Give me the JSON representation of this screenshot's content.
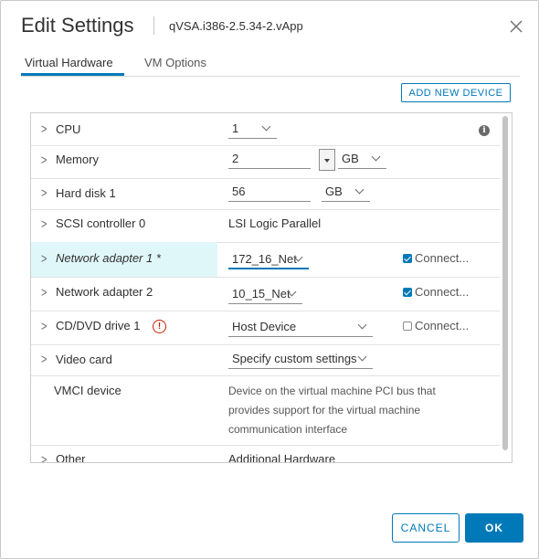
{
  "dialog": {
    "title": "Edit Settings",
    "subtitle": "qVSA.i386-2.5.34-2.vApp"
  },
  "tabs": [
    {
      "label": "Virtual Hardware",
      "active": true
    },
    {
      "label": "VM Options",
      "active": false
    }
  ],
  "add_device_label": "ADD NEW DEVICE",
  "rows": {
    "cpu": {
      "label": "CPU",
      "value": "1"
    },
    "memory": {
      "label": "Memory",
      "value": "2",
      "unit": "GB"
    },
    "hard_disk": {
      "label": "Hard disk 1",
      "value": "56",
      "unit": "GB"
    },
    "scsi": {
      "label": "SCSI controller 0",
      "value": "LSI Logic Parallel"
    },
    "net1": {
      "label": "Network adapter 1 *",
      "value": "172_16_Net",
      "connect_label": "Connect...",
      "connected": true
    },
    "net2": {
      "label": "Network adapter 2",
      "value": "10_15_Net",
      "connect_label": "Connect...",
      "connected": true
    },
    "cd": {
      "label": "CD/DVD drive 1",
      "value": "Host Device",
      "connect_label": "Connect...",
      "connected": false
    },
    "video": {
      "label": "Video card",
      "value": "Specify custom settings"
    },
    "vmci": {
      "label": "VMCI device",
      "desc_lines": [
        "Device on the virtual machine PCI bus that",
        "provides support for the virtual machine",
        "communication interface"
      ]
    },
    "other": {
      "label": "Other",
      "value": "Additional Hardware"
    }
  },
  "footer": {
    "cancel_label": "CANCEL",
    "ok_label": "OK"
  },
  "colors": {
    "accent": "#0079b8",
    "highlight": "#e0f7fa",
    "warning": "#c92100"
  },
  "icons": {
    "close": "close-icon",
    "info": "info-icon",
    "warning": "warning-icon",
    "chevron": "chevron-right-icon"
  }
}
